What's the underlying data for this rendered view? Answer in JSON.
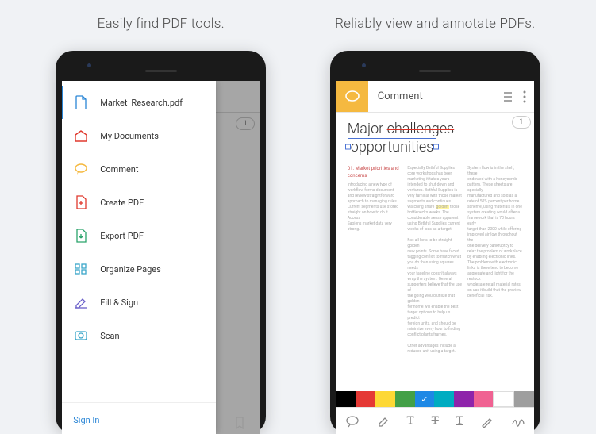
{
  "left": {
    "caption": "Easily find PDF tools.",
    "page_badge": "1",
    "drawer": {
      "items": [
        {
          "icon": "file-icon",
          "label": "Market_Research.pdf",
          "color": "#2a86d6"
        },
        {
          "icon": "home-icon",
          "label": "My Documents",
          "color": "#e0392e"
        },
        {
          "icon": "comment-icon",
          "label": "Comment",
          "color": "#f5b940"
        },
        {
          "icon": "create-pdf-icon",
          "label": "Create PDF",
          "color": "#e0392e"
        },
        {
          "icon": "export-pdf-icon",
          "label": "Export PDF",
          "color": "#2aa36b"
        },
        {
          "icon": "organize-pages-icon",
          "label": "Organize Pages",
          "color": "#3aa6c9"
        },
        {
          "icon": "fill-sign-icon",
          "label": "Fill & Sign",
          "color": "#6a5fc9"
        },
        {
          "icon": "scan-icon",
          "label": "Scan",
          "color": "#3aa6c9"
        }
      ],
      "footer": {
        "signin": "Sign In"
      }
    }
  },
  "right": {
    "caption": "Reliably view and annotate PDFs.",
    "toolbar": {
      "title": "Comment"
    },
    "page_badge": "1",
    "doc": {
      "title_pre": "Major ",
      "title_strike": "challenges",
      "title_annot": "opportunities",
      "col1_heading": "01. Market priorities and concerns"
    },
    "colors": [
      "#000000",
      "#e53935",
      "#fdd835",
      "#43a047",
      "#1e88e5",
      "#00acc1",
      "#8e24aa",
      "#f06292",
      "#ffffff",
      "#9e9e9e"
    ],
    "selected_color_index": 4
  }
}
